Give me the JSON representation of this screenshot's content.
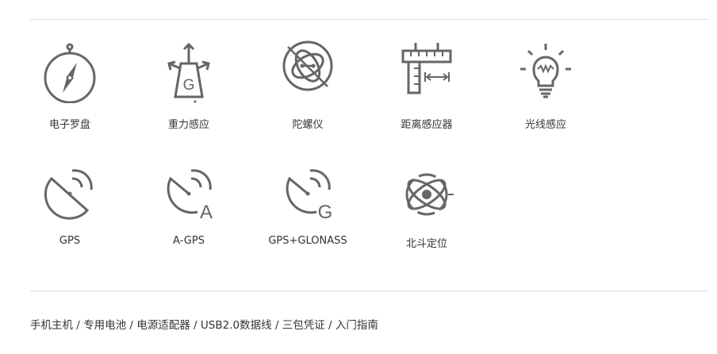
{
  "sensors": [
    {
      "label": "电子罗盘",
      "icon": "compass-icon"
    },
    {
      "label": "重力感应",
      "icon": "gravity-icon"
    },
    {
      "label": "陀螺仪",
      "icon": "gyroscope-icon"
    },
    {
      "label": "距离感应器",
      "icon": "proximity-sensor-icon"
    },
    {
      "label": "光线感应",
      "icon": "light-sensor-icon"
    },
    {
      "label": "GPS",
      "icon": "gps-icon"
    },
    {
      "label": "A-GPS",
      "icon": "a-gps-icon"
    },
    {
      "label": "GPS+GLONASS",
      "icon": "glonass-icon"
    },
    {
      "label": "北斗定位",
      "icon": "beidou-icon"
    }
  ],
  "dish_letters": {
    "agps": "A",
    "glonass": "G"
  },
  "gravity_letter": "G",
  "accessories": "手机主机 / 专用电池 / 电源适配器 / USB2.0数据线 / 三包凭证 / 入门指南",
  "colors": {
    "icon": "#666666",
    "divider": "#dcdcdc",
    "text": "#333333"
  }
}
